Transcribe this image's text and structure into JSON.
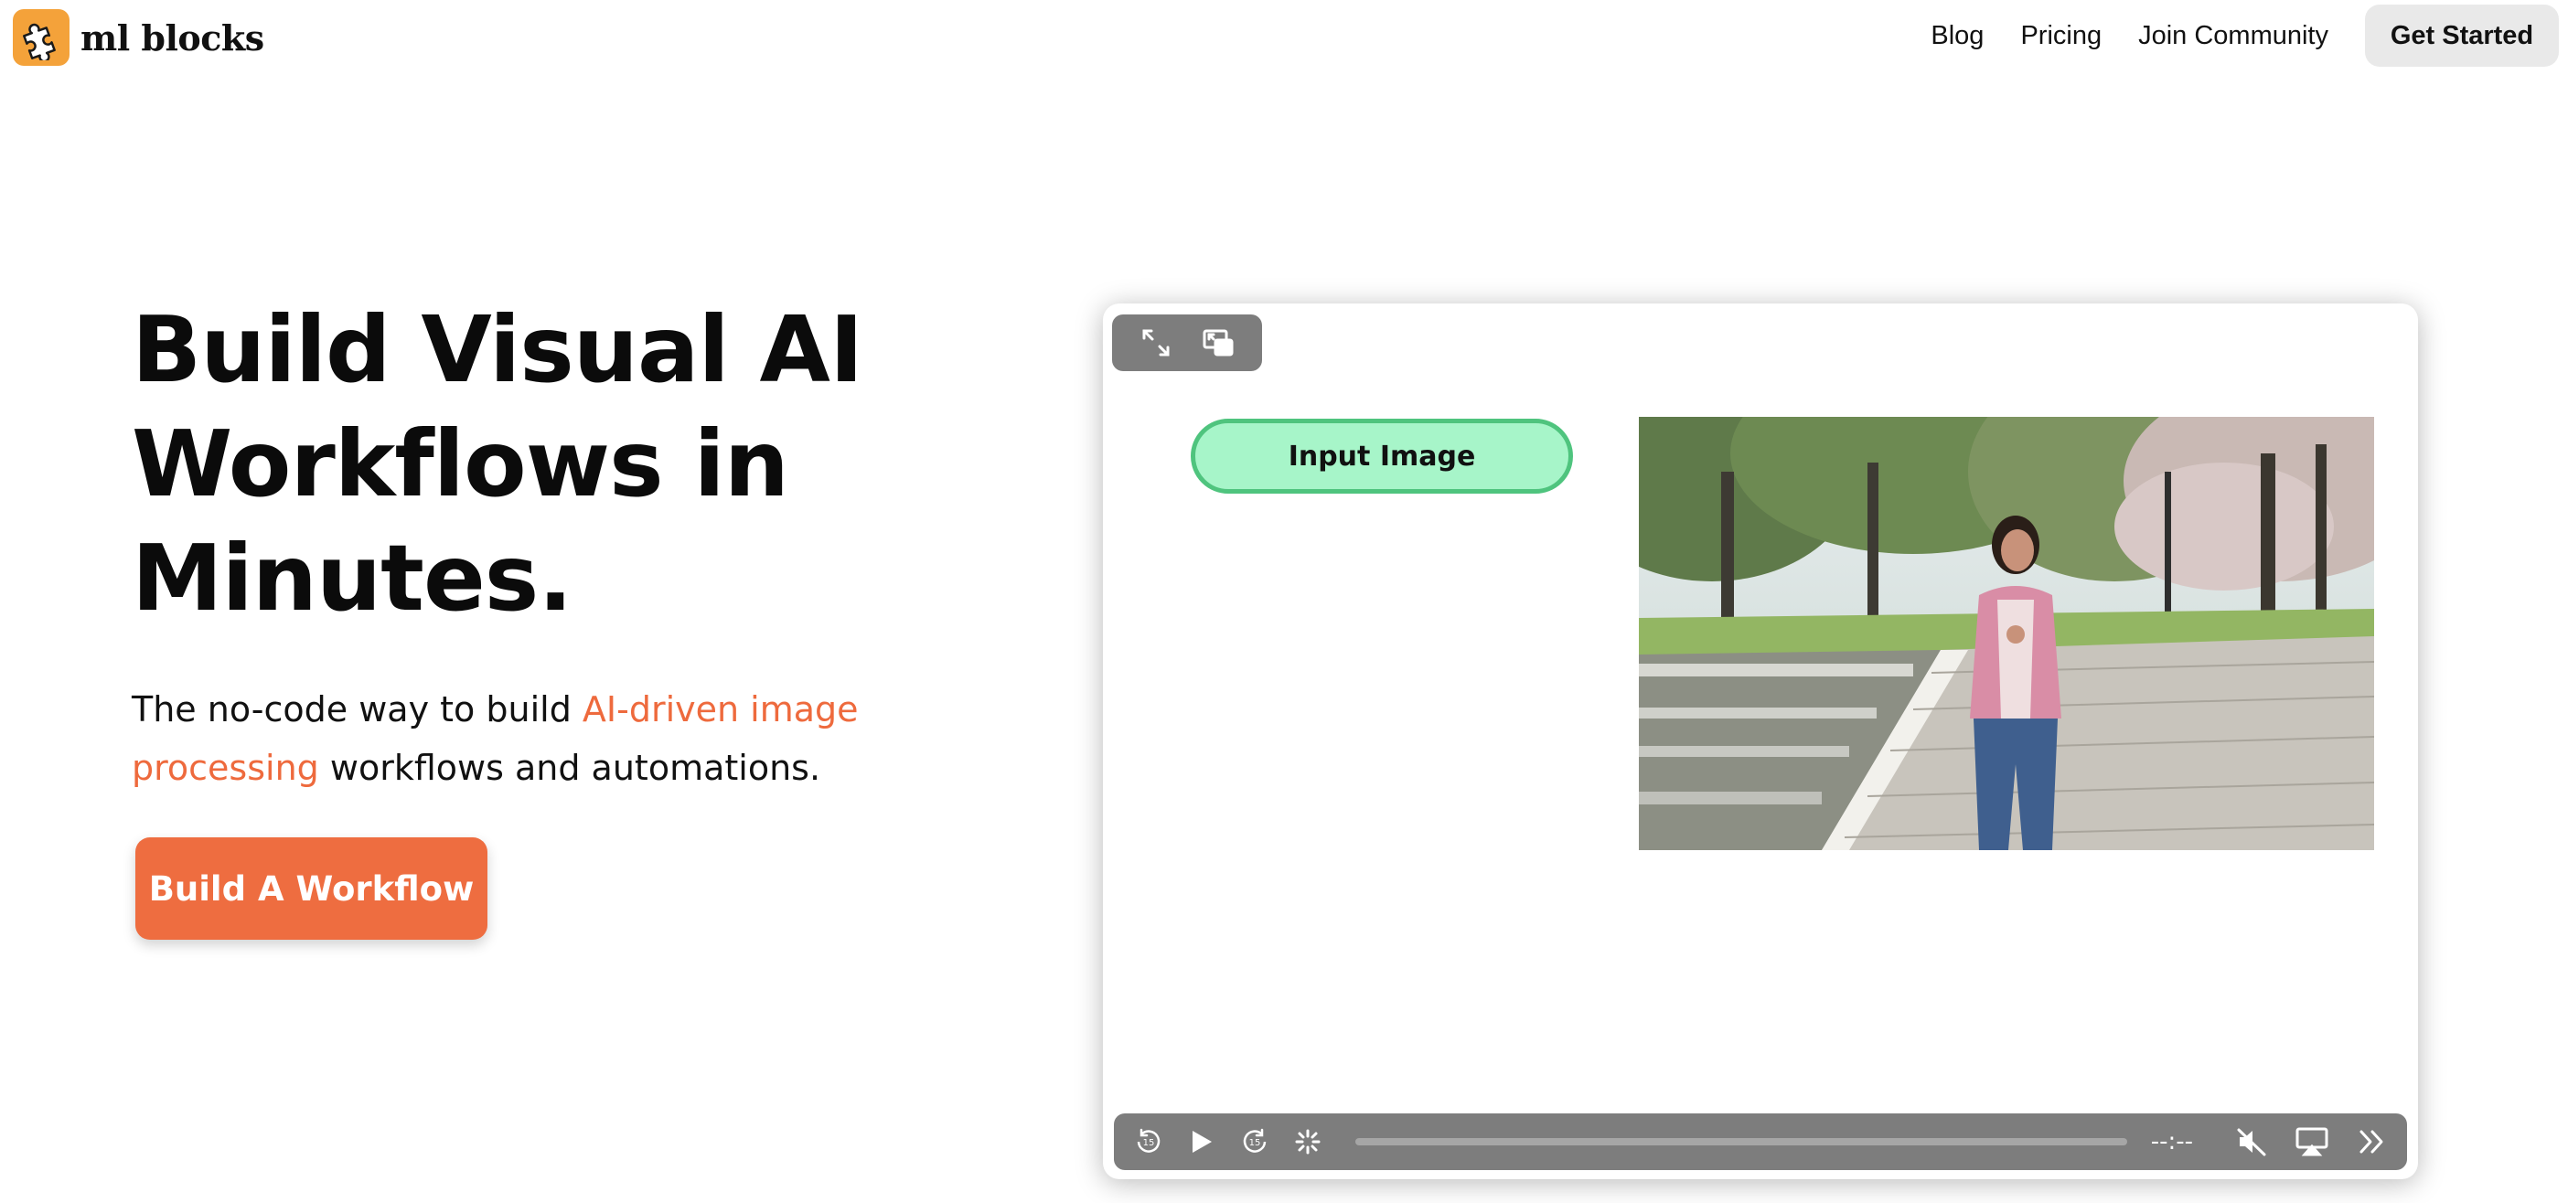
{
  "brand": {
    "name": "ml blocks",
    "logo_icon": "puzzle-piece-icon",
    "logo_color": "#f4a23a"
  },
  "nav": {
    "links": [
      "Blog",
      "Pricing",
      "Join Community"
    ],
    "cta": "Get Started"
  },
  "hero": {
    "headline": "Build Visual AI Workflows in Minutes.",
    "subline_before": "The no-code way to build ",
    "subline_accent": "AI-driven image processing",
    "subline_after": " workflows and automations.",
    "cta": "Build A Workflow",
    "accent_color": "#ee6a3d"
  },
  "video": {
    "top_controls": [
      "fullscreen-icon",
      "picture-in-picture-icon"
    ],
    "node_label": "Input Image",
    "photo_alt": "woman walking in park",
    "time": "--:--",
    "bottom_controls": [
      "rewind-15-icon",
      "play-icon",
      "forward-15-icon",
      "loading-spinner-icon",
      "mute-icon",
      "airplay-icon",
      "more-icon"
    ]
  }
}
